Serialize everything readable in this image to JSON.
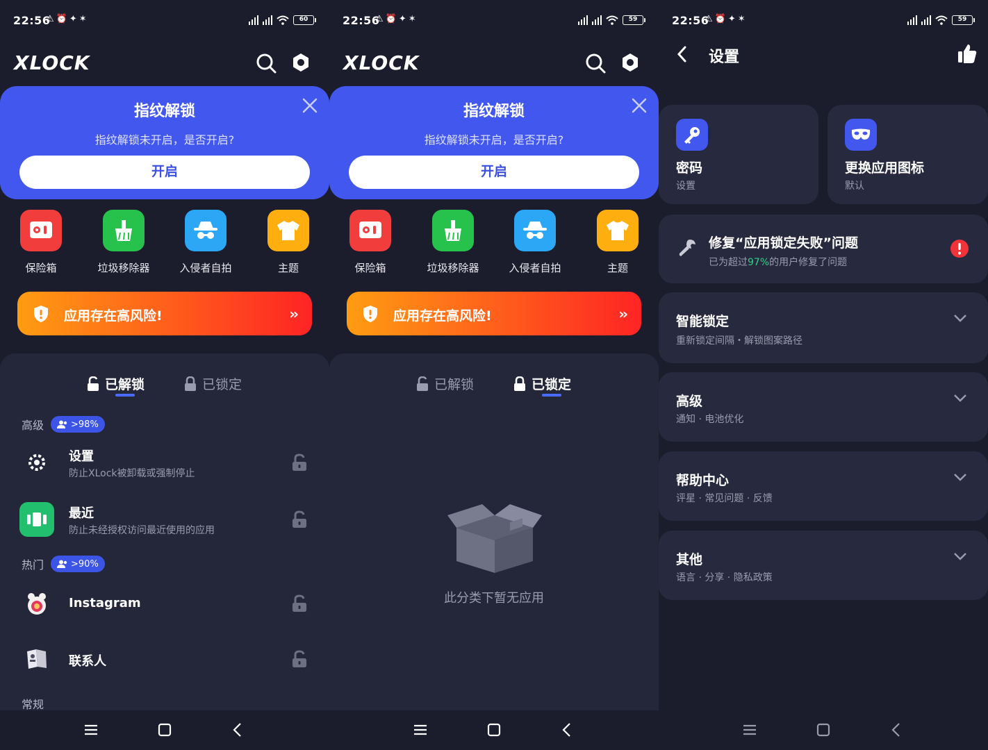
{
  "status": {
    "time": "22:56",
    "battery_1": "60",
    "battery_2": "59",
    "battery_3": "59",
    "hd": "HD"
  },
  "app": {
    "logo": "XLOCK"
  },
  "banner": {
    "title": "指纹解锁",
    "subtitle": "指纹解锁未开启，是否开启?",
    "button": "开启"
  },
  "tools": [
    {
      "label": "保险箱",
      "color": "#f23d3d",
      "icon": "safe-icon"
    },
    {
      "label": "垃圾移除器",
      "color": "#27c24c",
      "icon": "broom-icon"
    },
    {
      "label": "入侵者自拍",
      "color": "#2ba7f5",
      "icon": "spy-icon"
    },
    {
      "label": "主题",
      "color": "#ffae0f",
      "icon": "shirt-icon"
    }
  ],
  "risk": {
    "text": "应用存在高风险!",
    "chevron": "››"
  },
  "tabs": {
    "unlocked": "已解锁",
    "locked": "已锁定"
  },
  "sections": {
    "advanced": {
      "label": "高级",
      "badge": ">98%"
    },
    "popular": {
      "label": "热门",
      "badge": ">90%"
    },
    "general": {
      "label": "常规"
    }
  },
  "apps": [
    {
      "title": "设置",
      "subtitle": "防止XLock被卸载或强制停止"
    },
    {
      "title": "最近",
      "subtitle": "防止未经授权访问最近使用的应用"
    },
    {
      "title": "Instagram",
      "subtitle": ""
    },
    {
      "title": "联系人",
      "subtitle": ""
    }
  ],
  "empty": {
    "text": "此分类下暂无应用"
  },
  "settings": {
    "title": "设置",
    "password": {
      "title": "密码",
      "subtitle": "设置"
    },
    "icon_change": {
      "title": "更换应用图标",
      "subtitle": "默认"
    },
    "fix": {
      "title": "修复“应用锁定失败”问题",
      "sub_pre": "已为超过",
      "sub_pct": "97%",
      "sub_post": "的用户修复了问题"
    },
    "items": [
      {
        "title": "智能锁定",
        "subtitle": "重新锁定间隔・解锁图案路径"
      },
      {
        "title": "高级",
        "subtitle": "通知 · 电池优化"
      },
      {
        "title": "帮助中心",
        "subtitle": "评星 · 常见问题 · 反馈"
      },
      {
        "title": "其他",
        "subtitle": "语言 · 分享 · 隐私政策"
      }
    ]
  },
  "colors": {
    "accent": "#4257ee",
    "background": "#1b1c2c",
    "panel": "#24263a",
    "card": "#272a3e",
    "risk_start": "#ff9c12",
    "risk_end": "#ff2424",
    "highlight": "#2ed18c"
  }
}
